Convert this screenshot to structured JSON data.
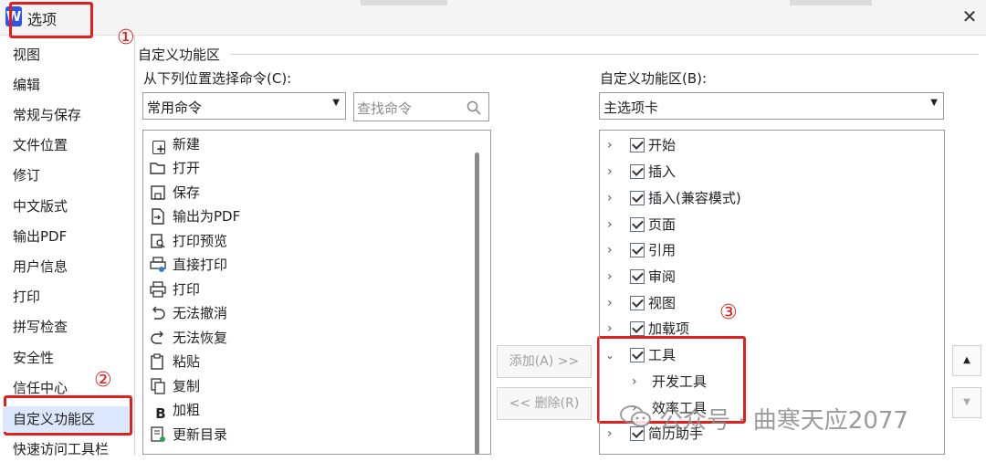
{
  "dialog": {
    "title": "选项",
    "logo_letter": "W"
  },
  "annotations": {
    "one": "①",
    "two": "②",
    "three": "③"
  },
  "nav": {
    "items": [
      "视图",
      "编辑",
      "常规与保存",
      "文件位置",
      "修订",
      "中文版式",
      "输出PDF",
      "用户信息",
      "打印",
      "拼写检查",
      "安全性",
      "信任中心",
      "自定义功能区",
      "快速访问工具栏"
    ],
    "active_index": 12
  },
  "section": {
    "title": "自定义功能区"
  },
  "left_panel": {
    "label": "从下列位置选择命令(C):",
    "dropdown_value": "常用命令",
    "search_placeholder": "查找命令",
    "commands": [
      {
        "label": "新建",
        "icon": "new-file-icon"
      },
      {
        "label": "打开",
        "icon": "folder-open-icon"
      },
      {
        "label": "保存",
        "icon": "save-icon"
      },
      {
        "label": "输出为PDF",
        "icon": "export-pdf-icon"
      },
      {
        "label": "打印预览",
        "icon": "print-preview-icon"
      },
      {
        "label": "直接打印",
        "icon": "quick-print-icon"
      },
      {
        "label": "打印",
        "icon": "print-icon"
      },
      {
        "label": "无法撤消",
        "icon": "undo-icon"
      },
      {
        "label": "无法恢复",
        "icon": "redo-icon"
      },
      {
        "label": "粘贴",
        "icon": "paste-icon"
      },
      {
        "label": "复制",
        "icon": "copy-icon"
      },
      {
        "label": "加粗",
        "icon": "bold-icon"
      },
      {
        "label": "更新目录",
        "icon": "update-toc-icon"
      }
    ]
  },
  "buttons": {
    "add": "添加(A) >>",
    "remove": "<< 删除(R)"
  },
  "right_panel": {
    "label": "自定义功能区(B):",
    "dropdown_value": "主选项卡",
    "tabs": [
      {
        "label": "开始",
        "checked": true
      },
      {
        "label": "插入",
        "checked": true
      },
      {
        "label": "插入(兼容模式)",
        "checked": true
      },
      {
        "label": "页面",
        "checked": true
      },
      {
        "label": "引用",
        "checked": true
      },
      {
        "label": "审阅",
        "checked": true
      },
      {
        "label": "视图",
        "checked": true
      },
      {
        "label": "加载项",
        "checked": true
      },
      {
        "label": "工具",
        "checked": true,
        "expanded": true,
        "children": [
          "开发工具",
          "效率工具"
        ]
      },
      {
        "label": "简历助手",
        "checked": true
      }
    ]
  },
  "watermark": {
    "text": "公众号 · 曲寒天应2077"
  }
}
